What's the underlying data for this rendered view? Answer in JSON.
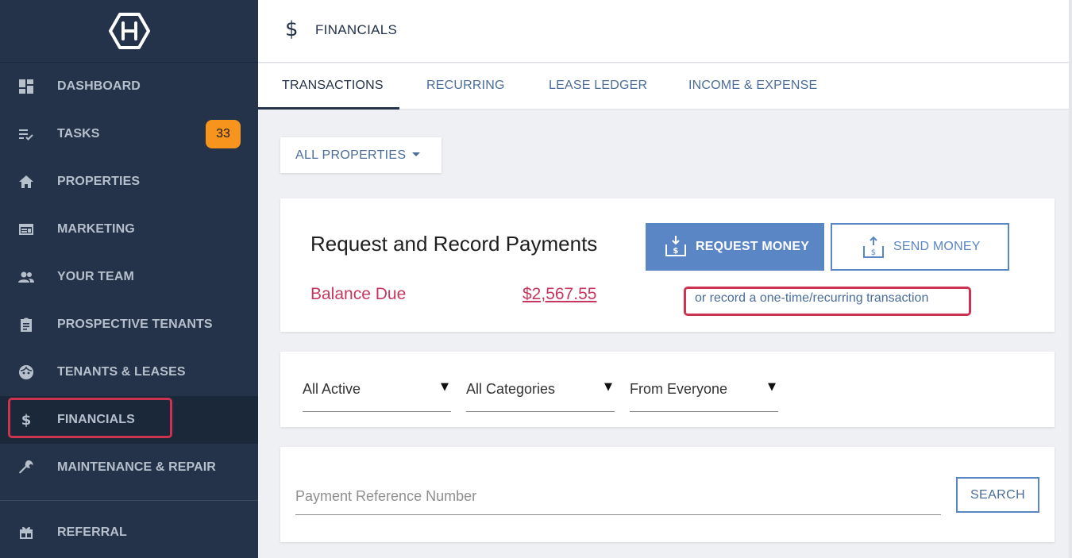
{
  "sidebar": {
    "logo_icon": "hexagon-h-logo",
    "items": [
      {
        "label": "DASHBOARD",
        "icon": "dashboard-icon"
      },
      {
        "label": "TASKS",
        "icon": "tasks-icon",
        "badge": "33"
      },
      {
        "label": "PROPERTIES",
        "icon": "home-icon"
      },
      {
        "label": "MARKETING",
        "icon": "marketing-icon"
      },
      {
        "label": "YOUR TEAM",
        "icon": "team-icon"
      },
      {
        "label": "PROSPECTIVE TENANTS",
        "icon": "clipboard-icon"
      },
      {
        "label": "TENANTS & LEASES",
        "icon": "tenant-face-icon"
      },
      {
        "label": "FINANCIALS",
        "icon": "dollar-icon",
        "active": true
      },
      {
        "label": "MAINTENANCE & REPAIR",
        "icon": "wrench-icon"
      },
      {
        "label": "REFERRAL",
        "icon": "gift-icon"
      }
    ]
  },
  "header": {
    "icon": "$",
    "title": "FINANCIALS"
  },
  "tabs": [
    {
      "label": "TRANSACTIONS",
      "active": true
    },
    {
      "label": "RECURRING"
    },
    {
      "label": "LEASE LEDGER"
    },
    {
      "label": "INCOME & EXPENSE"
    }
  ],
  "property_filter": {
    "selected": "ALL PROPERTIES"
  },
  "payments": {
    "title": "Request and Record Payments",
    "balance_label": "Balance Due",
    "balance_amount": "$2,567.55",
    "request_button": "REQUEST MONEY",
    "send_button": "SEND MONEY",
    "record_link": "or record a one-time/recurring transaction"
  },
  "filters": {
    "status": "All Active",
    "category": "All Categories",
    "party": "From Everyone"
  },
  "search": {
    "placeholder": "Payment Reference Number",
    "value": "",
    "button": "SEARCH"
  },
  "colors": {
    "sidebar_bg": "#243349",
    "accent": "#5b86c6",
    "balance": "#c7365f",
    "badge": "#f7941d",
    "highlight": "#cc3350"
  }
}
